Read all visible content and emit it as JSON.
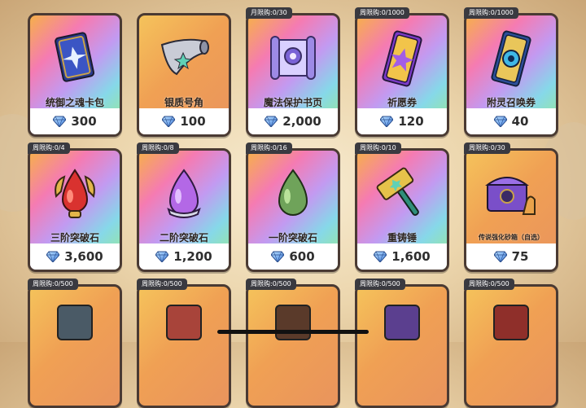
{
  "currency_icon": "blue-gem-icon",
  "rows": [
    {
      "items": [
        {
          "name": "统御之魂卡包",
          "price": "300",
          "limit": "",
          "icon": "soul-card-pack-icon",
          "style": "rainbow"
        },
        {
          "name": "银质号角",
          "price": "100",
          "limit": "",
          "icon": "silver-horn-icon",
          "style": "orange"
        },
        {
          "name": "魔法保护书页",
          "price": "2,000",
          "limit": "月限购:0/30",
          "icon": "magic-scroll-icon",
          "style": "rainbow"
        },
        {
          "name": "祈愿券",
          "price": "120",
          "limit": "周限购:0/1000",
          "icon": "wish-ticket-icon",
          "style": "rainbow"
        },
        {
          "name": "附灵召唤券",
          "price": "40",
          "limit": "周限购:0/1000",
          "icon": "spirit-summon-ticket-icon",
          "style": "rainbow"
        }
      ]
    },
    {
      "items": [
        {
          "name": "三阶突破石",
          "price": "3,600",
          "limit": "周限购:0/4",
          "icon": "tier3-breakthrough-stone-icon",
          "style": "rainbow"
        },
        {
          "name": "二阶突破石",
          "price": "1,200",
          "limit": "周限购:0/8",
          "icon": "tier2-breakthrough-stone-icon",
          "style": "rainbow"
        },
        {
          "name": "一阶突破石",
          "price": "600",
          "limit": "周限购:0/16",
          "icon": "tier1-breakthrough-stone-icon",
          "style": "rainbow"
        },
        {
          "name": "重铸锤",
          "price": "1,600",
          "limit": "周限购:0/10",
          "icon": "reforge-hammer-icon",
          "style": "rainbow"
        },
        {
          "name": "传说强化砂箱（自选）",
          "price": "75",
          "limit": "周限购:0/30",
          "icon": "legendary-sand-chest-icon",
          "style": "orange"
        }
      ]
    },
    {
      "items": [
        {
          "limit": "周限购:0/500",
          "style": "orange"
        },
        {
          "limit": "周限购:0/500",
          "style": "orange"
        },
        {
          "limit": "周限购:0/500",
          "style": "orange"
        },
        {
          "limit": "周限购:0/500",
          "style": "orange"
        },
        {
          "limit": "周限购:0/500",
          "style": "orange"
        }
      ]
    }
  ]
}
